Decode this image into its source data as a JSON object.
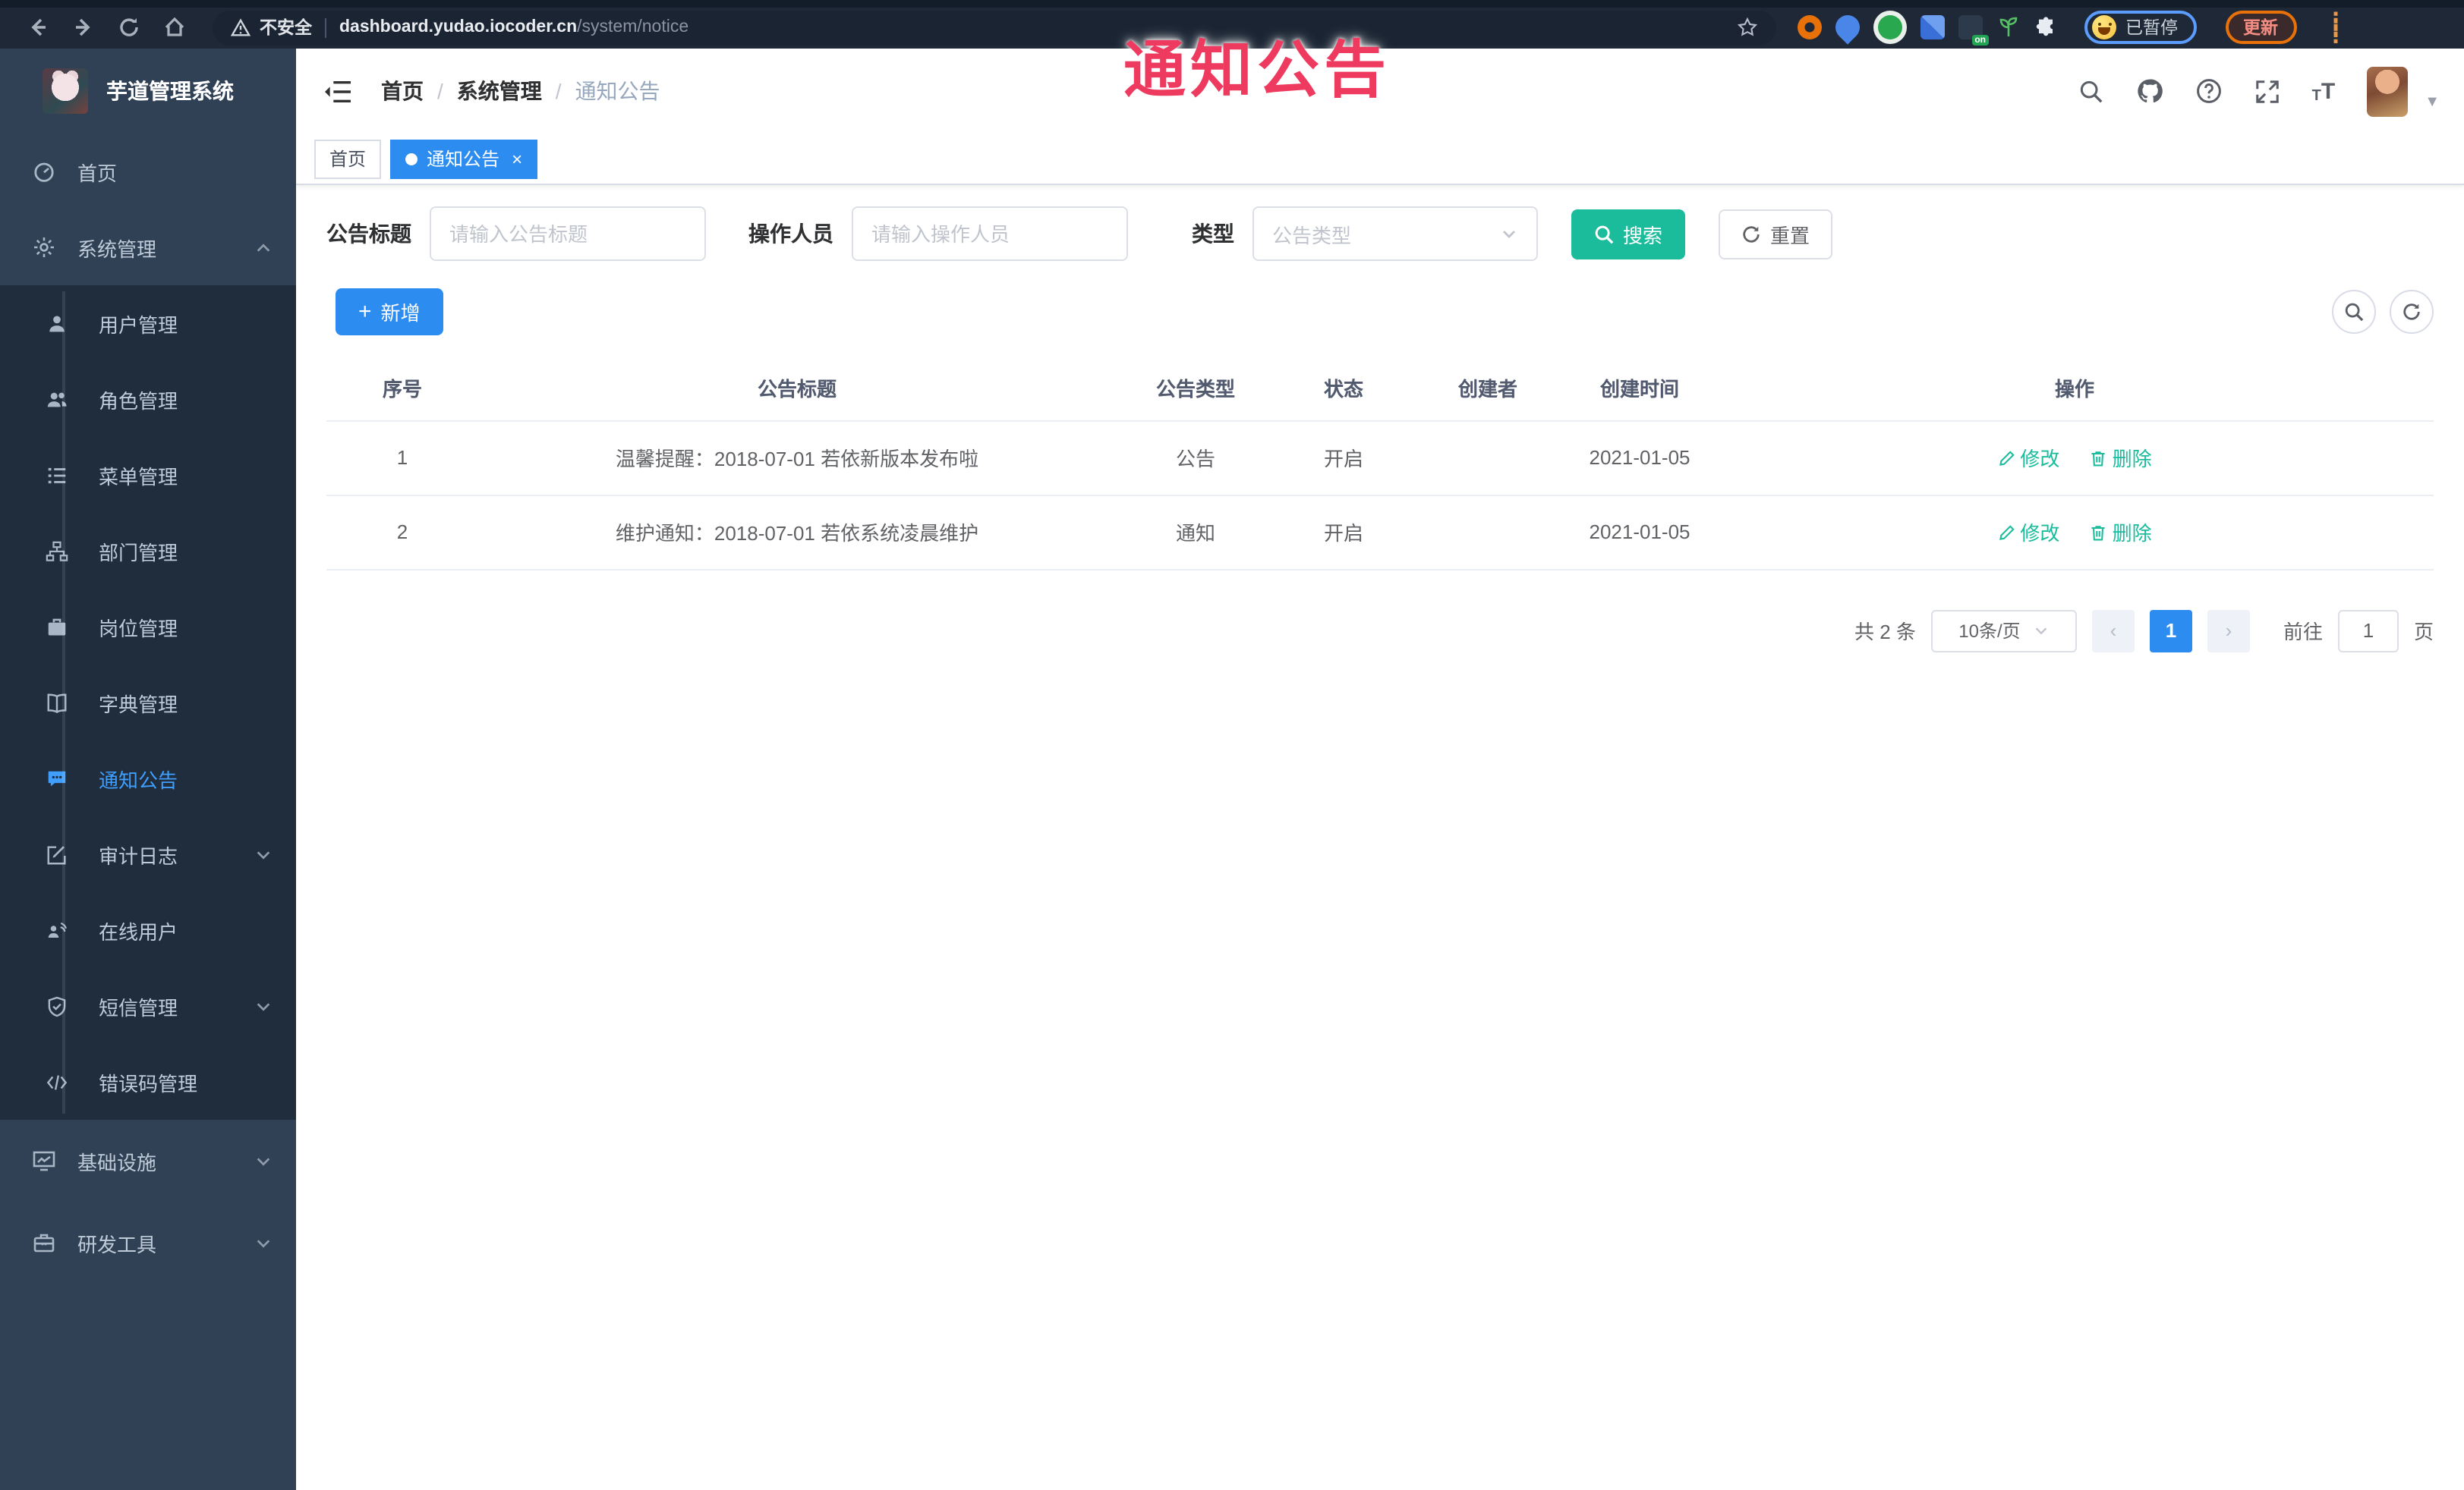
{
  "browser": {
    "secure_label": "不安全",
    "url_host": "dashboard.yudao.iocoder.cn",
    "url_path": "/system/notice",
    "paused_badge": "已暂停",
    "update_button": "更新"
  },
  "watermark": {
    "text": "通知公告",
    "color": "#ee3a5f"
  },
  "sidebar": {
    "title": "芋道管理系统",
    "items": [
      {
        "label": "首页"
      },
      {
        "label": "系统管理"
      },
      {
        "label": "用户管理"
      },
      {
        "label": "角色管理"
      },
      {
        "label": "菜单管理"
      },
      {
        "label": "部门管理"
      },
      {
        "label": "岗位管理"
      },
      {
        "label": "字典管理"
      },
      {
        "label": "通知公告"
      },
      {
        "label": "审计日志"
      },
      {
        "label": "在线用户"
      },
      {
        "label": "短信管理"
      },
      {
        "label": "错误码管理"
      },
      {
        "label": "基础设施"
      },
      {
        "label": "研发工具"
      }
    ]
  },
  "header": {
    "breadcrumb": [
      "首页",
      "系统管理",
      "通知公告"
    ]
  },
  "tabs": [
    {
      "label": "首页",
      "active": false
    },
    {
      "label": "通知公告",
      "active": true
    }
  ],
  "filter": {
    "title_label": "公告标题",
    "title_placeholder": "请输入公告标题",
    "operator_label": "操作人员",
    "operator_placeholder": "请输入操作人员",
    "type_label": "类型",
    "type_placeholder": "公告类型",
    "search_label": "搜索",
    "reset_label": "重置"
  },
  "toolbar": {
    "add_label": "新增"
  },
  "table": {
    "headers": [
      "序号",
      "公告标题",
      "公告类型",
      "状态",
      "创建者",
      "创建时间",
      "操作"
    ],
    "edit_label": "修改",
    "delete_label": "删除",
    "rows": [
      {
        "no": "1",
        "title": "温馨提醒：2018-07-01 若依新版本发布啦",
        "type": "公告",
        "status": "开启",
        "creator": "",
        "created": "2021-01-05"
      },
      {
        "no": "2",
        "title": "维护通知：2018-07-01 若依系统凌晨维护",
        "type": "通知",
        "status": "开启",
        "creator": "",
        "created": "2021-01-05"
      }
    ]
  },
  "pagination": {
    "total": "共 2 条",
    "page_size": "10条/页",
    "prev": "‹",
    "current": "1",
    "next": "›",
    "goto_label": "前往",
    "goto_value": "1",
    "page_label": "页"
  },
  "colors": {
    "accent_blue": "#2d8cf0",
    "accent_teal": "#1abc9c",
    "sidebar_bg": "#304156",
    "submenu_bg": "#1f2d3d",
    "active_text": "#409eff"
  }
}
